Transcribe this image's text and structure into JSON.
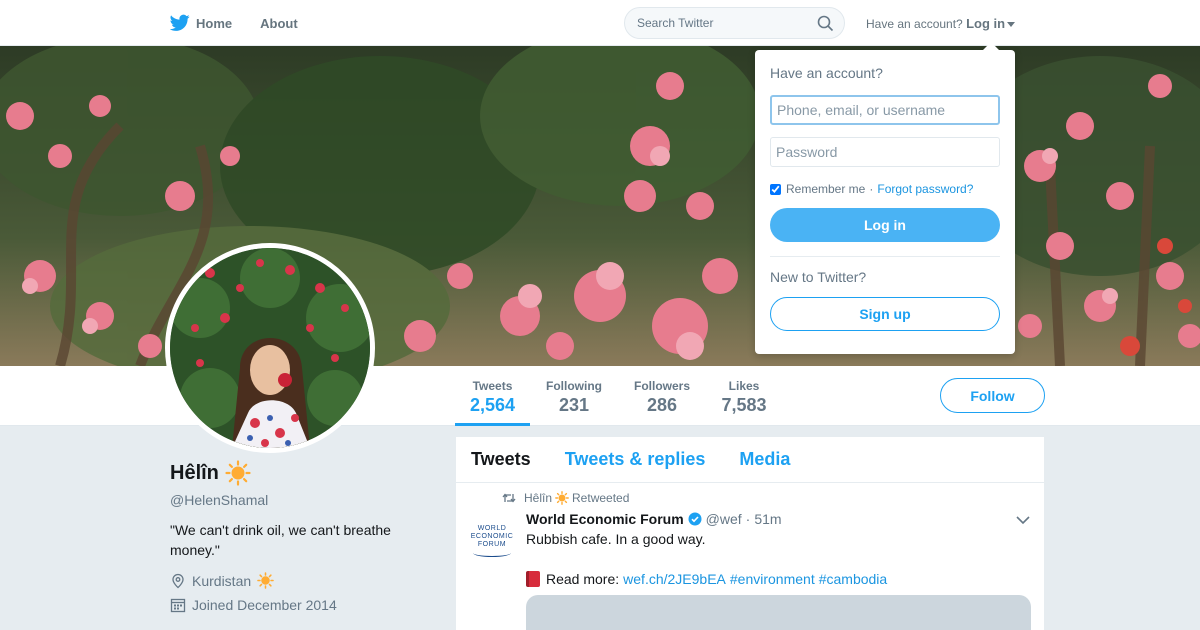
{
  "nav": {
    "home_label": "Home",
    "about_label": "About",
    "search_placeholder": "Search Twitter",
    "account_prompt": "Have an account?",
    "login_label": "Log in",
    "brand_color": "#1da1f2"
  },
  "login_dropdown": {
    "title": "Have an account?",
    "username_placeholder": "Phone, email, or username",
    "password_placeholder": "Password",
    "remember_label": "Remember me",
    "separator": "·",
    "forgot_label": "Forgot password?",
    "login_button": "Log in",
    "new_prompt": "New to Twitter?",
    "signup_button": "Sign up"
  },
  "profile": {
    "name": "Hêlîn",
    "handle": "@HelenShamal",
    "bio": "\"We can't drink oil, we can't breathe money.\"",
    "location": "Kurdistan",
    "joined": "Joined December 2014"
  },
  "stats": [
    {
      "label": "Tweets",
      "value": "2,564"
    },
    {
      "label": "Following",
      "value": "231"
    },
    {
      "label": "Followers",
      "value": "286"
    },
    {
      "label": "Likes",
      "value": "7,583"
    }
  ],
  "follow_button": "Follow",
  "tabs": [
    {
      "label": "Tweets"
    },
    {
      "label": "Tweets & replies"
    },
    {
      "label": "Media"
    }
  ],
  "tweet": {
    "retweeter": "Hêlîn",
    "retweeted_label": "Retweeted",
    "author_name": "World Economic Forum",
    "author_handle": "@wef",
    "separator": "·",
    "time": "51m",
    "text": "Rubbish cafe. In a good way.",
    "read_more": "Read more:",
    "link": "wef.ch/2JE9bEA",
    "hashtag1": "#environment",
    "hashtag2": "#cambodia",
    "logo_line1": "WORLD",
    "logo_line2": "ECONOMIC",
    "logo_line3": "FORUM"
  }
}
